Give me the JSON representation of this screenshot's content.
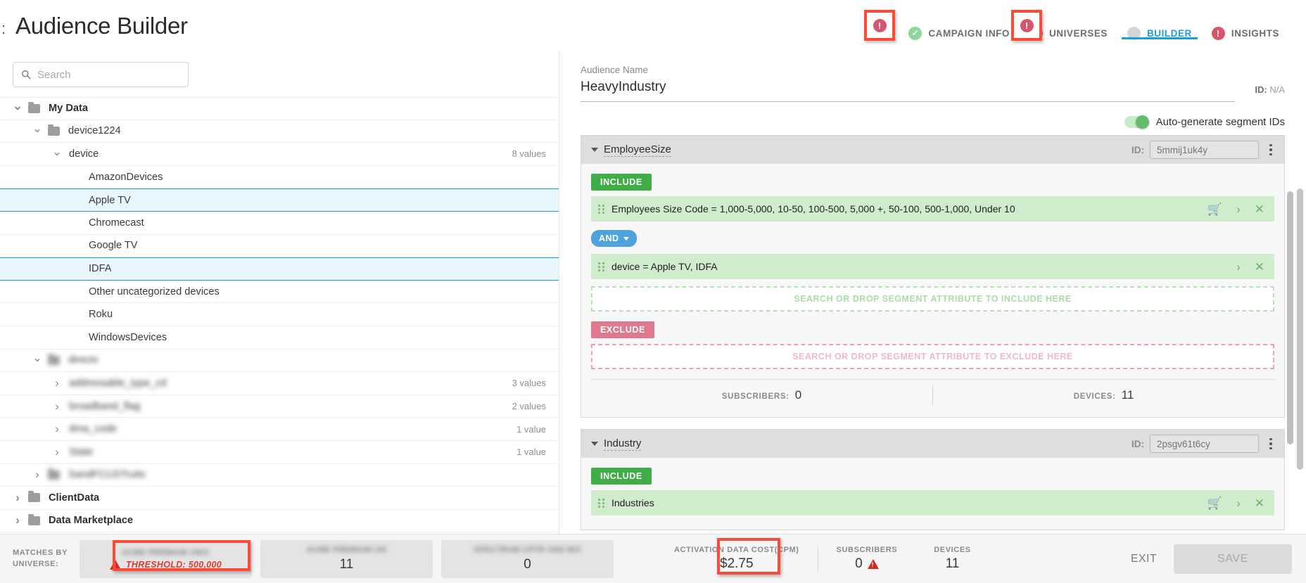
{
  "header": {
    "title": "Audience Builder",
    "tabs": [
      {
        "label": "CAMPAIGN INFO",
        "icon": "check-circle-icon",
        "state": "complete"
      },
      {
        "label": "UNIVERSES",
        "icon": "error-circle-icon",
        "state": "error"
      },
      {
        "label": "BUILDER",
        "icon": "neutral-circle-icon",
        "state": "active"
      },
      {
        "label": "INSIGHTS",
        "icon": "error-circle-icon",
        "state": "error"
      }
    ]
  },
  "sidebar": {
    "search": {
      "value": "",
      "placeholder": "Search",
      "icon": "search-icon"
    },
    "tree": [
      {
        "label": "My Data",
        "depth": 0,
        "chevron": "down",
        "folder": true,
        "bold": true,
        "count": "",
        "selected": false,
        "blurred": false
      },
      {
        "label": "device1224",
        "depth": 1,
        "chevron": "down",
        "folder": true,
        "bold": false,
        "count": "",
        "selected": false,
        "blurred": false
      },
      {
        "label": "device",
        "depth": 2,
        "chevron": "down",
        "folder": false,
        "bold": false,
        "count": "8 values",
        "selected": false,
        "blurred": false
      },
      {
        "label": "AmazonDevices",
        "depth": 3,
        "chevron": "none",
        "folder": false,
        "bold": false,
        "count": "",
        "selected": false,
        "blurred": false
      },
      {
        "label": "Apple TV",
        "depth": 3,
        "chevron": "none",
        "folder": false,
        "bold": false,
        "count": "",
        "selected": true,
        "blurred": false
      },
      {
        "label": "Chromecast",
        "depth": 3,
        "chevron": "none",
        "folder": false,
        "bold": false,
        "count": "",
        "selected": false,
        "blurred": false
      },
      {
        "label": "Google TV",
        "depth": 3,
        "chevron": "none",
        "folder": false,
        "bold": false,
        "count": "",
        "selected": false,
        "blurred": false
      },
      {
        "label": "IDFA",
        "depth": 3,
        "chevron": "none",
        "folder": false,
        "bold": false,
        "count": "",
        "selected": true,
        "blurred": false
      },
      {
        "label": "Other uncategorized devices",
        "depth": 3,
        "chevron": "none",
        "folder": false,
        "bold": false,
        "count": "",
        "selected": false,
        "blurred": false
      },
      {
        "label": "Roku",
        "depth": 3,
        "chevron": "none",
        "folder": false,
        "bold": false,
        "count": "",
        "selected": false,
        "blurred": false
      },
      {
        "label": "WindowsDevices",
        "depth": 3,
        "chevron": "none",
        "folder": false,
        "bold": false,
        "count": "",
        "selected": false,
        "blurred": false
      },
      {
        "label": "directv",
        "depth": 1,
        "chevron": "down",
        "folder": true,
        "bold": false,
        "count": "",
        "selected": false,
        "blurred": true
      },
      {
        "label": "addressable_type_cd",
        "depth": 2,
        "chevron": "right",
        "folder": false,
        "bold": false,
        "count": "3 values",
        "selected": false,
        "blurred": true
      },
      {
        "label": "broadband_flag",
        "depth": 2,
        "chevron": "right",
        "folder": false,
        "bold": false,
        "count": "2 values",
        "selected": false,
        "blurred": true
      },
      {
        "label": "dma_code",
        "depth": 2,
        "chevron": "right",
        "folder": false,
        "bold": false,
        "count": "1 value",
        "selected": false,
        "blurred": true
      },
      {
        "label": "State",
        "depth": 2,
        "chevron": "right",
        "folder": false,
        "bold": false,
        "count": "1 value",
        "selected": false,
        "blurred": true
      },
      {
        "label": "SandFCUSTruits",
        "depth": 1,
        "chevron": "right",
        "folder": true,
        "bold": false,
        "count": "",
        "selected": false,
        "blurred": true
      },
      {
        "label": "ClientData",
        "depth": 0,
        "chevron": "right",
        "folder": true,
        "bold": true,
        "count": "",
        "selected": false,
        "blurred": false
      },
      {
        "label": "Data Marketplace",
        "depth": 0,
        "chevron": "right",
        "folder": true,
        "bold": true,
        "count": "",
        "selected": false,
        "blurred": false
      }
    ]
  },
  "main": {
    "audience_name_label": "Audience Name",
    "audience_name_value": "HeavyIndustry",
    "audience_name_placeholder": "Audience Name",
    "id_label": "ID:",
    "id_value": "N/A",
    "autogen_label": "Auto-generate segment IDs",
    "autogen_on": true,
    "segments": [
      {
        "title": "EmployeeSize",
        "id_label": "ID:",
        "id_value": "5mmij1uk4y",
        "id_placeholder": "5mmij1uk4y",
        "include_tag": "INCLUDE",
        "exclude_tag": "EXCLUDE",
        "include_dropzone": "SEARCH OR DROP SEGMENT ATTRIBUTE TO INCLUDE HERE",
        "exclude_dropzone": "SEARCH OR DROP SEGMENT ATTRIBUTE TO EXCLUDE HERE",
        "attributes": [
          {
            "text": "Employees Size Code = 1,000-5,000, 10-50, 100-500, 5,000 +, 50-100, 500-1,000, Under 10",
            "cart": true
          },
          {
            "text": "device = Apple TV, IDFA",
            "cart": false
          }
        ],
        "operator": "AND",
        "stats": [
          {
            "label": "SUBSCRIBERS:",
            "value": "0"
          },
          {
            "label": "DEVICES:",
            "value": "11"
          }
        ]
      },
      {
        "title": "Industry",
        "id_label": "ID:",
        "id_value": "2psgv61t6cy",
        "id_placeholder": "2psgv61t6cy",
        "include_tag": "INCLUDE",
        "attributes": [
          {
            "text": "Industries",
            "cart": true
          }
        ]
      }
    ]
  },
  "footer": {
    "matches_label": "MATCHES BY UNIVERSE:",
    "universes": [
      {
        "name": "",
        "value": "THRESHOLD: 500,000",
        "threshold": true,
        "blurred_name": true
      },
      {
        "name": "",
        "value": "11",
        "threshold": false,
        "blurred_name": true
      },
      {
        "name": "",
        "value": "0",
        "threshold": false,
        "blurred_name": true
      }
    ],
    "stats": [
      {
        "label": "ACTIVATION DATA COST(CPM)",
        "value": "$2.75",
        "warn": false
      },
      {
        "label": "SUBSCRIBERS",
        "value": "0",
        "warn": true
      },
      {
        "label": "DEVICES",
        "value": "11",
        "warn": false
      }
    ],
    "exit_label": "EXIT",
    "save_label": "SAVE"
  },
  "colors": {
    "accent": "#1a9ee0",
    "include_green": "#3fae46",
    "exclude_pink": "#e0798e",
    "error_red": "#d9556c",
    "annotation_red": "#fd4b36",
    "threshold_red": "#e03b2f"
  }
}
